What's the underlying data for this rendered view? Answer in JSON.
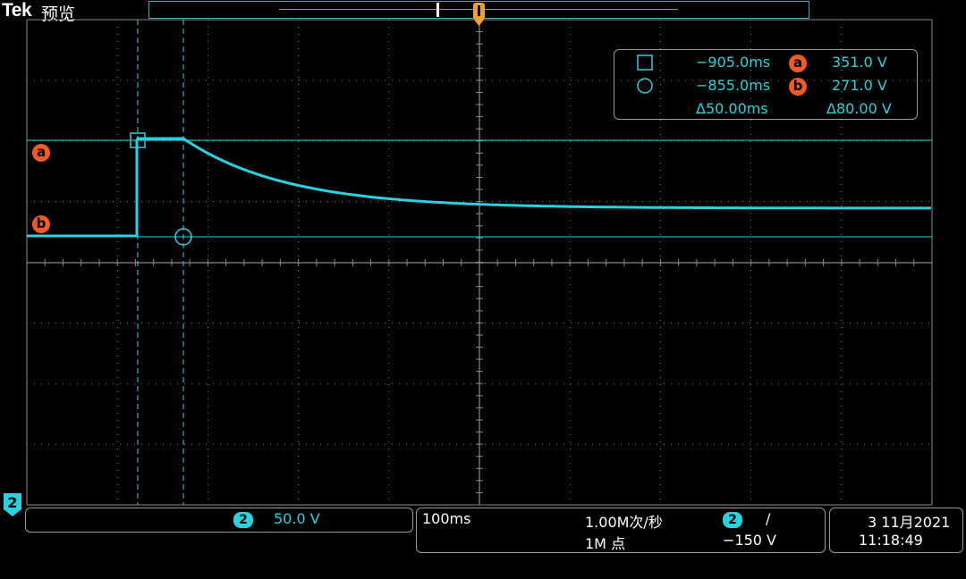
{
  "header": {
    "brand": "Tek",
    "mode": "预览"
  },
  "cursors": {
    "cursor_a": {
      "time": "−905.0ms",
      "label": "a",
      "value": "351.0 V"
    },
    "cursor_b": {
      "time": "−855.0ms",
      "label": "b",
      "value": "271.0 V"
    },
    "delta_time": "Δ50.00ms",
    "delta_value": "Δ80.00 V",
    "markers": {
      "a": "a",
      "b": "b"
    }
  },
  "channel": {
    "number": "2",
    "scale": "50.0 V",
    "ground_marker": "2",
    "color": "#27d3e0"
  },
  "timebase": {
    "horizontal_scale": "100ms",
    "sample_rate": "1.00M次/秒",
    "record_length": "1M 点",
    "trigger_channel": "2",
    "trigger_slope": "/",
    "trigger_level": "−150 V"
  },
  "clock": {
    "date": "3 11月2021",
    "time": "11:18:49"
  },
  "colors": {
    "waveform": "#27d3e0",
    "cursor_marker": "#f15a22",
    "trigger_marker": "#f0a030",
    "grid": "#8a8a8a"
  }
}
